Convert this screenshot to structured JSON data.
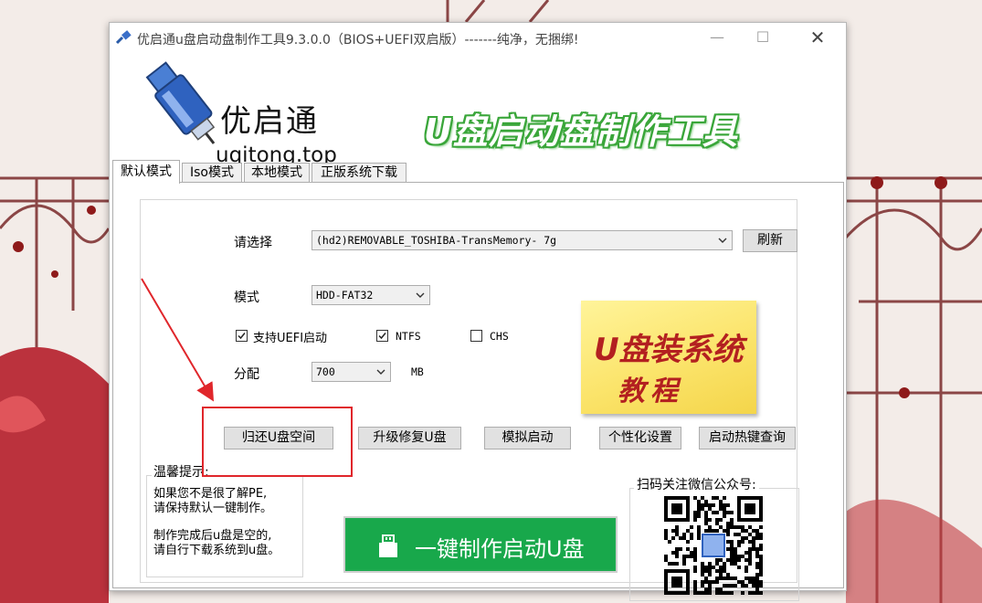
{
  "window": {
    "title": "优启通u盘启动盘制作工具9.3.0.0（BIOS+UEFI双启版）-------纯净，无捆绑!",
    "min_glyph": "—",
    "max_glyph": "☐",
    "close_glyph": "✕"
  },
  "header": {
    "brand_name": "优启通",
    "brand_url": "uqitong.top",
    "banner": "U盘启动盘制作工具",
    "accent_color": "#3aa63a"
  },
  "tabs": [
    {
      "label": "默认模式",
      "active": true
    },
    {
      "label": "Iso模式",
      "active": false
    },
    {
      "label": "本地模式",
      "active": false
    },
    {
      "label": "正版系统下载",
      "active": false
    }
  ],
  "form": {
    "select_label": "请选择",
    "device_value": "(hd2)REMOVABLE_TOSHIBA-TransMemory- 7g",
    "refresh_label": "刷新",
    "mode_label": "模式",
    "mode_value": "HDD-FAT32",
    "uefi_label": "支持UEFI启动",
    "uefi_checked": true,
    "ntfs_label": "NTFS",
    "ntfs_checked": true,
    "chs_label": "CHS",
    "chs_checked": false,
    "alloc_label": "分配",
    "alloc_value": "700",
    "alloc_unit": "MB"
  },
  "sticky": {
    "line1": "U盘装系统",
    "line2": "教程"
  },
  "actions": {
    "restore": "归还U盘空间",
    "upgrade": "升级修复U盘",
    "simulate": "模拟启动",
    "personalize": "个性化设置",
    "hotkey": "启动热键查询"
  },
  "tips": {
    "title": "温馨提示:",
    "line1": "如果您不是很了解PE,",
    "line2": "请保持默认一键制作。",
    "line3": "制作完成后u盘是空的,",
    "line4": "请自行下载系统到u盘。"
  },
  "make_button": {
    "label": "一键制作启动U盘",
    "color": "#18a84b"
  },
  "qr": {
    "title": "扫码关注微信公众号:"
  },
  "annotation": {
    "color": "#e0262b"
  }
}
